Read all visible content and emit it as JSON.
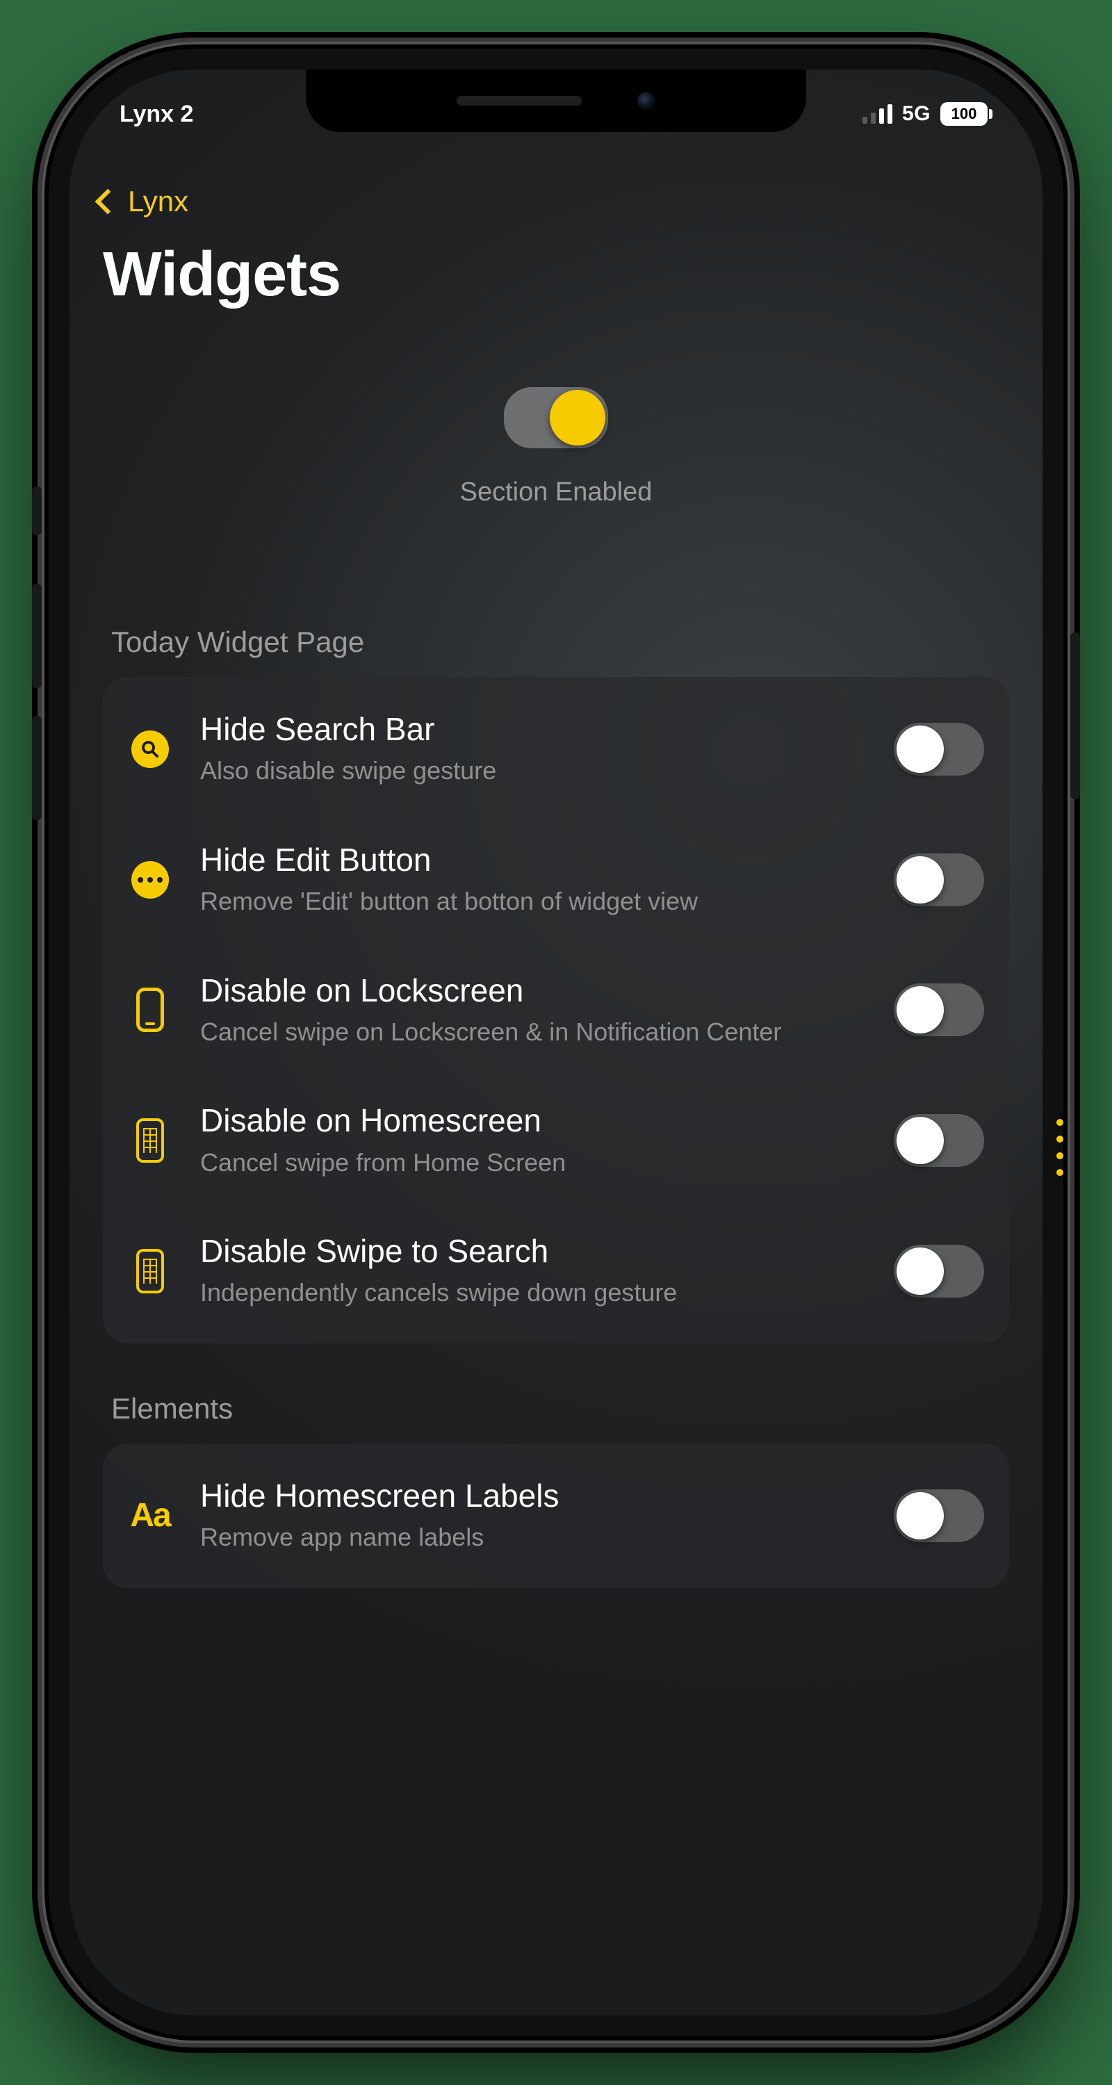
{
  "status": {
    "left": "Lynx 2",
    "network": "5G",
    "battery": "100"
  },
  "nav": {
    "back_label": "Lynx",
    "title": "Widgets"
  },
  "section_toggle": {
    "label": "Section Enabled",
    "on": true
  },
  "groups": [
    {
      "header": "Today Widget Page",
      "rows": [
        {
          "icon": "search",
          "title": "Hide Search Bar",
          "sub": "Also disable swipe gesture",
          "on": false
        },
        {
          "icon": "dots",
          "title": "Hide Edit Button",
          "sub": "Remove 'Edit' button at botton of widget view",
          "on": false
        },
        {
          "icon": "phone-outline",
          "title": "Disable on Lockscreen",
          "sub": "Cancel swipe on Lockscreen & in Notification Center",
          "on": false
        },
        {
          "icon": "phone-grid",
          "title": "Disable on Homescreen",
          "sub": "Cancel swipe from Home Screen",
          "on": false
        },
        {
          "icon": "phone-grid",
          "title": "Disable Swipe to Search",
          "sub": "Independently cancels swipe down gesture",
          "on": false
        }
      ]
    },
    {
      "header": "Elements",
      "rows": [
        {
          "icon": "aa",
          "title": "Hide Homescreen Labels",
          "sub": "Remove app name labels",
          "on": false
        }
      ]
    }
  ]
}
